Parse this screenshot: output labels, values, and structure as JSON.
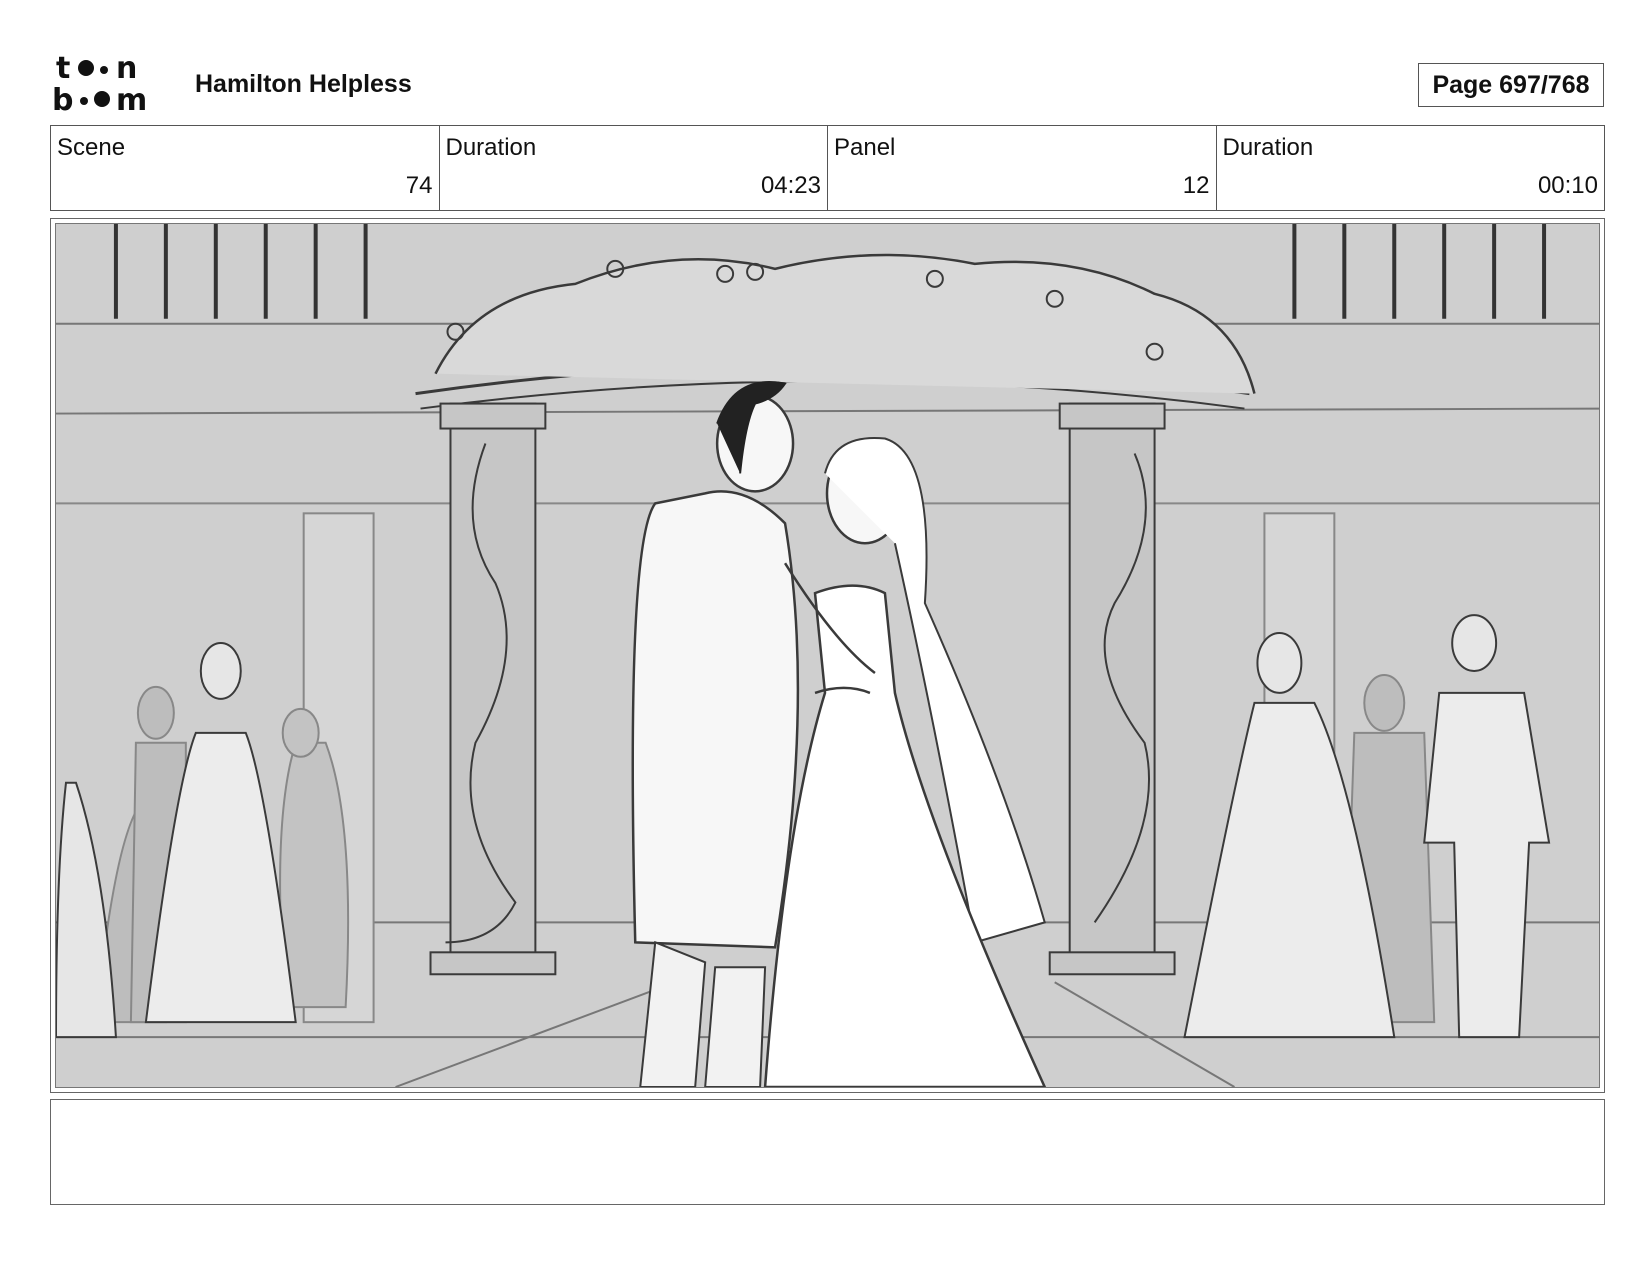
{
  "header": {
    "logo_text": "toon boom",
    "project_title": "Hamilton Helpless",
    "page_counter": "Page 697/768"
  },
  "info": [
    {
      "label": "Scene",
      "value": "74"
    },
    {
      "label": "Duration",
      "value": "04:23"
    },
    {
      "label": "Panel",
      "value": "12"
    },
    {
      "label": "Duration",
      "value": "00:10"
    }
  ],
  "panel": {
    "background_color": "#cfcfcf",
    "line_color": "#3a3a3a"
  },
  "notes": {
    "text": ""
  }
}
